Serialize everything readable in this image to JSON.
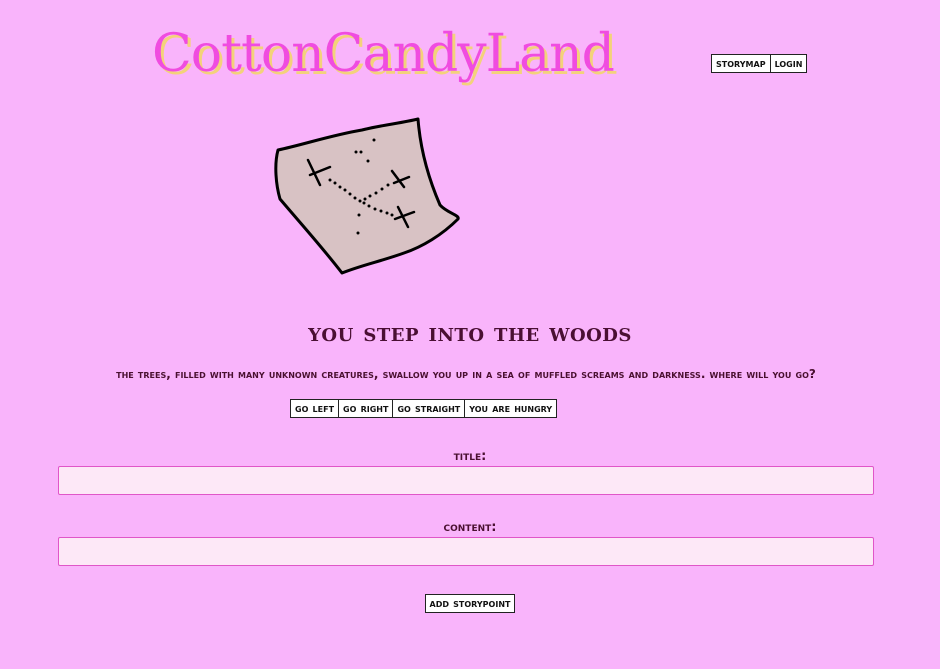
{
  "header": {
    "site_title": "CottonCandyLand",
    "nav": {
      "storymap_label": "storymap",
      "login_label": "login"
    }
  },
  "scene": {
    "title": "You step into the woods",
    "description": "The trees, filled with many unknown creatures, swallow you up in a sea of muffled screams and darkness. Where will you go?",
    "choices": [
      {
        "label": "go left"
      },
      {
        "label": "go right"
      },
      {
        "label": "go straight"
      },
      {
        "label": "you are hungry"
      }
    ]
  },
  "form": {
    "title_label": "title:",
    "title_value": "",
    "content_label": "content:",
    "content_value": "",
    "submit_label": "add storypoint"
  },
  "colors": {
    "background": "#f9b4fb",
    "title_pink": "#f04ce0",
    "title_shadow": "#f3d27a",
    "input_bg": "#fde8f7",
    "input_border": "#e056c8"
  },
  "icons": {
    "map": "treasure-map-icon"
  }
}
